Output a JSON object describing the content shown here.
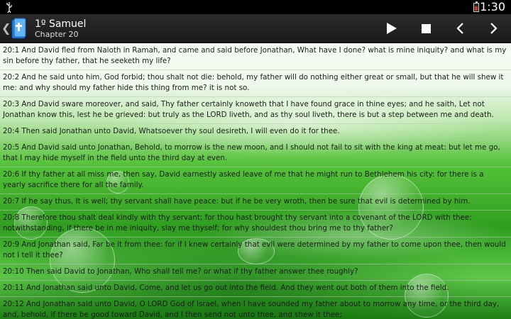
{
  "status": {
    "time": "1:30"
  },
  "header": {
    "title": "1º Samuel",
    "subtitle": "Chapter 20"
  },
  "verses": [
    "20:1 And David fled from Naioth in Ramah, and came and said before Jonathan, What have I done? what is mine iniquity? and what is my sin before thy father, that he seeketh my life?",
    "20:2 And he said unto him, God forbid; thou shalt not die: behold, my father will do nothing either great or small, but that he will shew it me: and why should my father hide this thing from me? it is not so.",
    "20:3 And David sware moreover, and said, Thy father certainly knoweth that I have found grace in thine eyes; and he saith, Let not Jonathan know this, lest he be grieved: but truly as the LORD liveth, and as thy soul liveth, there is but a step between me and death.",
    "20:4 Then said Jonathan unto David, Whatsoever thy soul desireth, I will even do it for thee.",
    "20:5 And David said unto Jonathan, Behold, to morrow is the new moon, and I should not fail to sit with the king at meat: but let me go, that I may hide myself in the field unto the third day at even.",
    "20:6 If thy father at all miss me, then say, David earnestly asked leave of me that he might run to Bethlehem his city: for there is a yearly sacrifice there for all the family.",
    "20:7 If he say thus, It is well; thy servant shall have peace: but if he be very wroth, then be sure that evil is determined by him.",
    "20:8 Therefore thou shalt deal kindly with thy servant; for thou hast brought thy servant into a covenant of the LORD with thee: notwithstanding, if there be in me iniquity, slay me thyself; for why shouldest thou bring me to thy father?",
    "20:9 And Jonathan said, Far be it from thee: for if I knew certainly that evil were determined by my father to come upon thee, then would not I tell it thee?",
    "20:10 Then said David to Jonathan, Who shall tell me? or what if thy father answer thee roughly?",
    "20:11 And Jonathan said unto David, Come, and let us go out into the field. And they went out both of them into the field.",
    "20:12 And Jonathan said unto David, O LORD God of Israel, when I have sounded my father about to morrow any time, or the third day, and, behold, if there be good toward David, and I then send not unto thee, and shew it thee;"
  ]
}
